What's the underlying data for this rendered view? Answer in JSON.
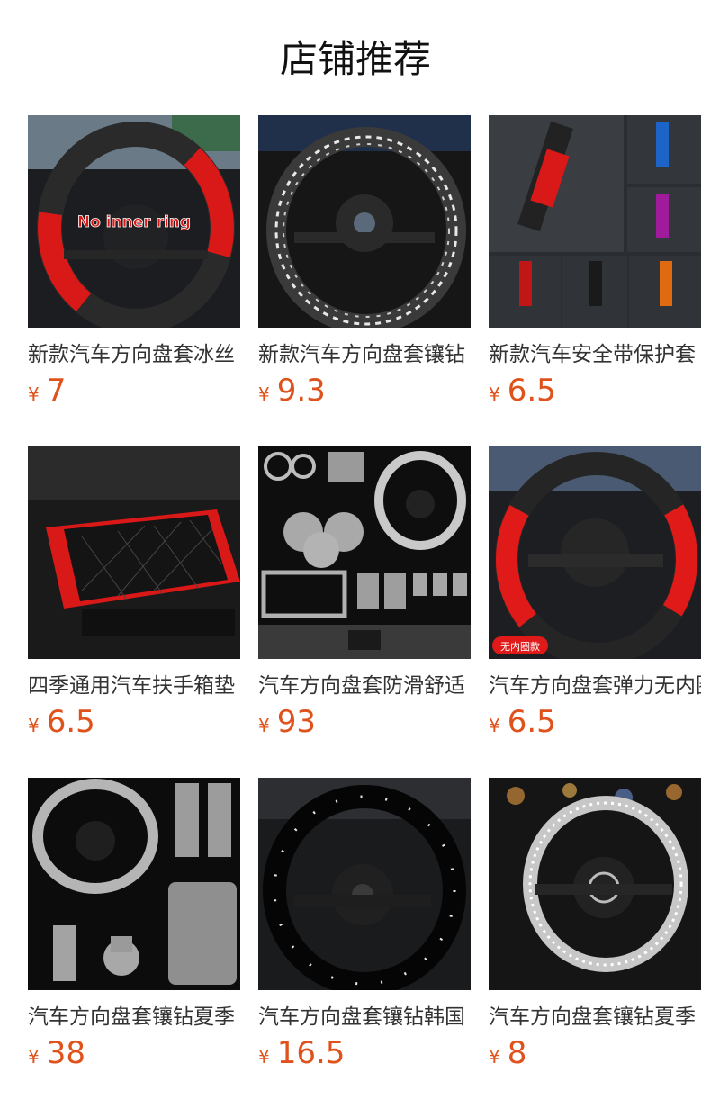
{
  "page": {
    "title": "店铺推荐"
  },
  "colors": {
    "price": "#e0521b",
    "title": "#111111",
    "product_name": "#333333"
  },
  "products": [
    {
      "name": "新款汽车方向盘套冰丝",
      "currency": "¥",
      "price": "7",
      "image_label": "No inner ring",
      "image_icon": "steering-wheel-cover-red-black"
    },
    {
      "name": "新款汽车方向盘套镶钻",
      "currency": "¥",
      "price": "9.3",
      "image_icon": "rhinestone-steering-wheel-cover"
    },
    {
      "name": "新款汽车安全带保护套",
      "currency": "¥",
      "price": "6.5",
      "image_icon": "seat-belt-cover"
    },
    {
      "name": "四季通用汽车扶手箱垫",
      "currency": "¥",
      "price": "6.5",
      "image_icon": "armrest-cushion"
    },
    {
      "name": "汽车方向盘套防滑舒适",
      "currency": "¥",
      "price": "93",
      "image_icon": "rhinestone-accessory-set"
    },
    {
      "name": "汽车方向盘套弹力无内圈",
      "currency": "¥",
      "price": "6.5",
      "image_label": "无内圈款",
      "image_icon": "steering-wheel-cover-red-carbon"
    },
    {
      "name": "汽车方向盘套镶钻夏季",
      "currency": "¥",
      "price": "38",
      "image_icon": "rhinestone-interior-set"
    },
    {
      "name": "汽车方向盘套镶钻韩国",
      "currency": "¥",
      "price": "16.5",
      "image_icon": "black-studded-steering-wheel-cover"
    },
    {
      "name": "汽车方向盘套镶钻夏季",
      "currency": "¥",
      "price": "8",
      "image_icon": "silver-rhinestone-steering-wheel-cover"
    }
  ]
}
